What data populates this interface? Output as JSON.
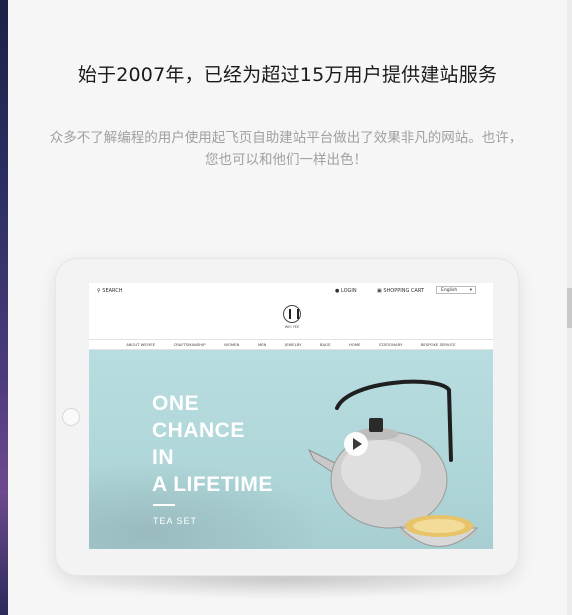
{
  "section": {
    "headline": "始于2007年，已经为超过15万用户提供建站服务",
    "subtext_line1": "众多不了解编程的用户使用起飞页自助建站平台做出了效果非凡的网站。也许，",
    "subtext_line2": "您也可以和他们一样出色！"
  },
  "preview": {
    "topbar": {
      "search": "SEARCH",
      "login": "LOGIN",
      "cart": "SHOPPING CART",
      "language": "English"
    },
    "logo_caption": "WEI YEE",
    "nav": [
      "ABOUT WEIYEE",
      "CRAFTSMANSHIP",
      "WOMEN",
      "MEN",
      "JEWELRY",
      "BAGS",
      "HOME",
      "STATIONARY",
      "BESPOKE SERVICE"
    ],
    "hero": {
      "line1": "ONE",
      "line2": "CHANCE",
      "line3": "IN",
      "line4": "A LIFETIME",
      "subtitle": "TEA SET"
    },
    "icons": {
      "search": "search-icon",
      "login": "user-icon",
      "cart": "cart-icon",
      "play": "play-icon"
    }
  }
}
